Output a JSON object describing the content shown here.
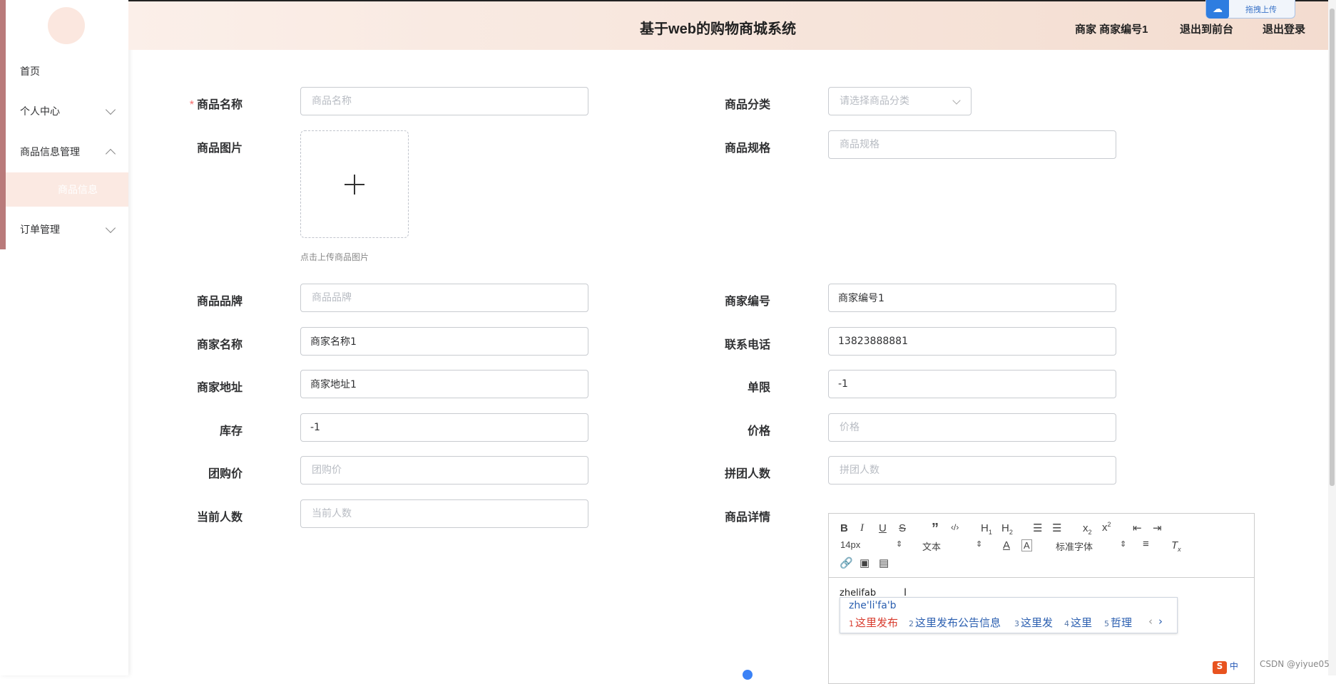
{
  "header": {
    "title": "基于web的购物商城系统",
    "user_label": "商家 商家编号1",
    "back_to_front": "退出到前台",
    "logout": "退出登录"
  },
  "upload_widget": {
    "label": "拖拽上传"
  },
  "sidebar": {
    "items": [
      {
        "label": "首页"
      },
      {
        "label": "个人中心"
      },
      {
        "label": "商品信息管理"
      },
      {
        "label": "商品信息"
      },
      {
        "label": "订单管理"
      }
    ]
  },
  "form": {
    "name": {
      "label": "商品名称",
      "required_mark": "*",
      "placeholder": "商品名称",
      "value": ""
    },
    "category": {
      "label": "商品分类",
      "placeholder": "请选择商品分类",
      "value": ""
    },
    "image": {
      "label": "商品图片",
      "tip": "点击上传商品图片"
    },
    "spec": {
      "label": "商品规格",
      "placeholder": "商品规格",
      "value": ""
    },
    "brand": {
      "label": "商品品牌",
      "placeholder": "商品品牌",
      "value": ""
    },
    "merchant_no": {
      "label": "商家编号",
      "placeholder": "",
      "value": "商家编号1"
    },
    "merchant_name": {
      "label": "商家名称",
      "placeholder": "",
      "value": "商家名称1"
    },
    "phone": {
      "label": "联系电话",
      "placeholder": "",
      "value": "13823888881"
    },
    "merchant_addr": {
      "label": "商家地址",
      "placeholder": "",
      "value": "商家地址1"
    },
    "limit": {
      "label": "单限",
      "placeholder": "",
      "value": "-1"
    },
    "stock": {
      "label": "库存",
      "placeholder": "",
      "value": "-1"
    },
    "price": {
      "label": "价格",
      "placeholder": "价格",
      "value": ""
    },
    "group_price": {
      "label": "团购价",
      "placeholder": "团购价",
      "value": ""
    },
    "group_size": {
      "label": "拼团人数",
      "placeholder": "拼团人数",
      "value": ""
    },
    "current_count": {
      "label": "当前人数",
      "placeholder": "当前人数",
      "value": ""
    },
    "detail": {
      "label": "商品详情"
    }
  },
  "editor": {
    "font_size": "14px",
    "paragraph": "文本",
    "font_family": "标准字体",
    "content": "zhelifab"
  },
  "ime": {
    "composition": "zhe'li'fa'b",
    "candidates": [
      {
        "n": "1",
        "text": "这里发布"
      },
      {
        "n": "2",
        "text": "这里发布公告信息"
      },
      {
        "n": "3",
        "text": "这里发"
      },
      {
        "n": "4",
        "text": "这里"
      },
      {
        "n": "5",
        "text": "哲理"
      }
    ]
  },
  "tray": {
    "lang": "中"
  },
  "watermark": "CSDN @yiyue05"
}
